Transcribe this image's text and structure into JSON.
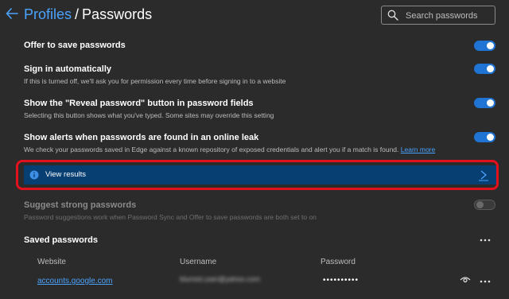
{
  "header": {
    "breadcrumb_parent": "Profiles",
    "breadcrumb_separator": "/",
    "breadcrumb_current": "Passwords",
    "search_placeholder": "Search passwords"
  },
  "settings": {
    "offer_save": {
      "title": "Offer to save passwords",
      "enabled": true
    },
    "sign_in_auto": {
      "title": "Sign in automatically",
      "description": "If this is turned off, we'll ask you for permission every time before signing in to a website",
      "enabled": true
    },
    "reveal_button": {
      "title": "Show the \"Reveal password\" button in password fields",
      "description": "Selecting this button shows what you've typed. Some sites may override this setting",
      "enabled": true
    },
    "leak_alerts": {
      "title": "Show alerts when passwords are found in an online leak",
      "description": "We check your passwords saved in Edge against a known repository of exposed credentials and alert you if a match is found.",
      "learn_more": "Learn more",
      "enabled": true
    },
    "view_results": {
      "label": "View results"
    },
    "suggest_strong": {
      "title": "Suggest strong passwords",
      "description": "Password suggestions work when Password Sync and Offer to save passwords are both set to on",
      "enabled": false
    }
  },
  "saved": {
    "title": "Saved passwords",
    "columns": {
      "website": "Website",
      "username": "Username",
      "password": "Password"
    },
    "rows": [
      {
        "website": "accounts.google.com",
        "username": "blurred.user@yahoo.com",
        "password": "••••••••••"
      }
    ]
  },
  "colors": {
    "background": "#2b2b2b",
    "accent": "#1f74d4",
    "link": "#4aa3ff",
    "highlight_border": "#e3101e",
    "view_results_bg": "#073f73"
  },
  "icons": [
    "back-arrow-icon",
    "search-icon",
    "info-icon",
    "chevron-right-icon",
    "more-icon",
    "eye-icon"
  ]
}
